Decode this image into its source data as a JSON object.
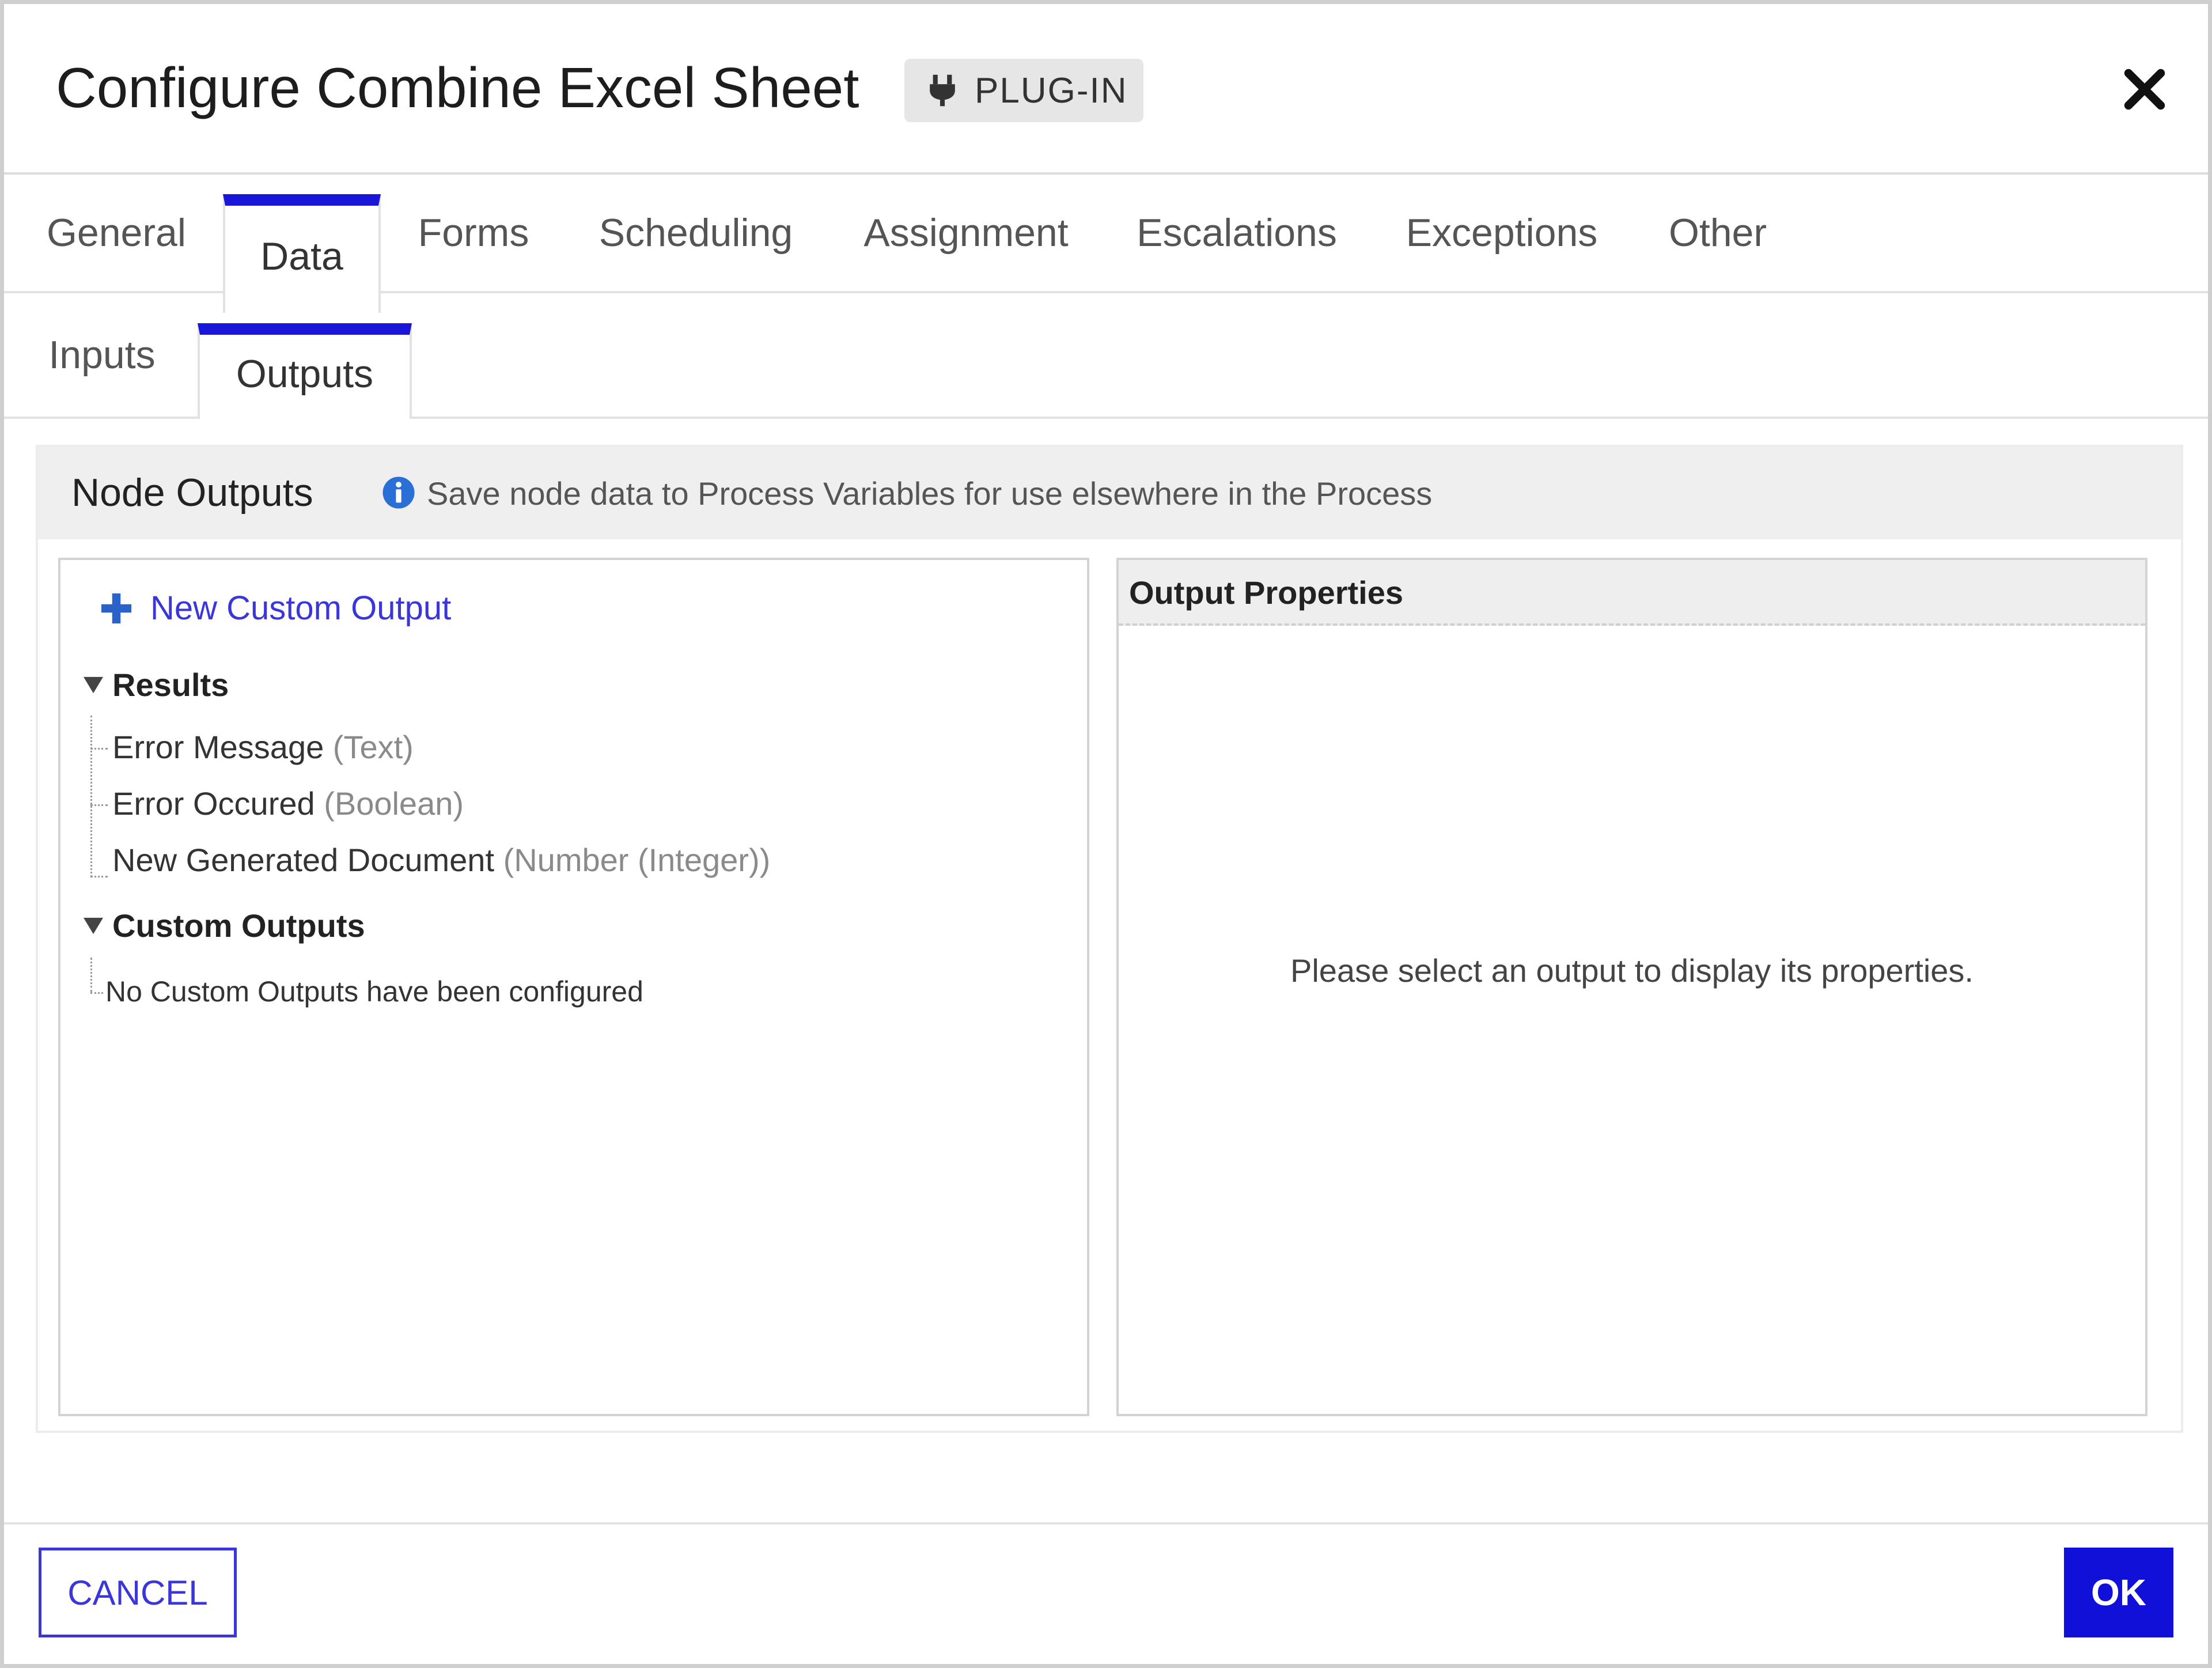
{
  "dialog": {
    "title": "Configure Combine Excel Sheet",
    "badge": "PLUG-IN"
  },
  "tabs": [
    "General",
    "Data",
    "Forms",
    "Scheduling",
    "Assignment",
    "Escalations",
    "Exceptions",
    "Other"
  ],
  "active_tab": "Data",
  "subtabs": [
    "Inputs",
    "Outputs"
  ],
  "active_subtab": "Outputs",
  "section": {
    "title": "Node Outputs",
    "hint": "Save node data to Process Variables for use elsewhere in the Process"
  },
  "tree": {
    "new_output_label": "New Custom Output",
    "groups": [
      {
        "label": "Results",
        "items": [
          {
            "name": "Error Message",
            "type": "(Text)"
          },
          {
            "name": "Error Occured",
            "type": "(Boolean)"
          },
          {
            "name": "New Generated Document",
            "type": "(Number (Integer))"
          }
        ]
      },
      {
        "label": "Custom Outputs",
        "empty_text": "No Custom Outputs have been configured"
      }
    ]
  },
  "properties": {
    "title": "Output Properties",
    "empty_text": "Please select an output to display its properties."
  },
  "footer": {
    "cancel_label": "CANCEL",
    "ok_label": "OK"
  },
  "colors": {
    "accent": "#1a16d9",
    "link": "#3a36d9",
    "ok_button": "#1010d8"
  },
  "icons": {
    "badge": "plug-icon",
    "close": "close-icon",
    "info": "info-icon",
    "add": "plus-icon",
    "expand": "triangle-down-icon"
  }
}
